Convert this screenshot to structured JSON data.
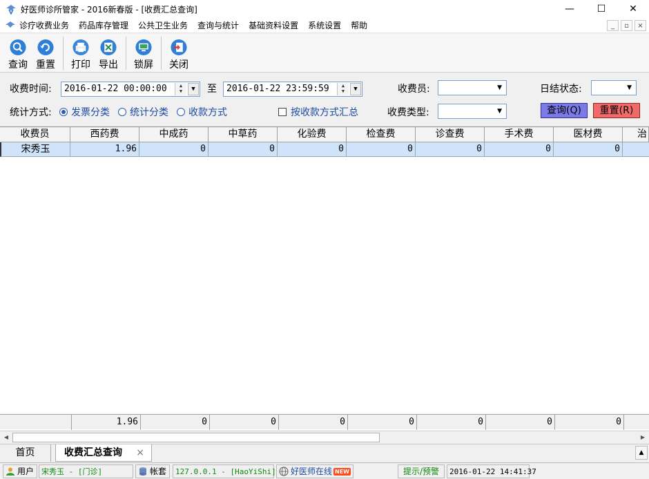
{
  "window": {
    "title": "好医师诊所管家 - 2016新春版 - [收费汇总查询]",
    "controls": [
      "—",
      "☐",
      "✕"
    ]
  },
  "menu": {
    "items": [
      "诊疗收费业务",
      "药品库存管理",
      "公共卫生业务",
      "查询与统计",
      "基础资料设置",
      "系统设置",
      "帮助"
    ],
    "mdi_controls": [
      "_",
      "▫",
      "×"
    ]
  },
  "toolbar": {
    "buttons": [
      {
        "label": "查询",
        "icon": "search-icon"
      },
      {
        "label": "重置",
        "icon": "refresh-icon"
      },
      {
        "label": "打印",
        "icon": "printer-icon"
      },
      {
        "label": "导出",
        "icon": "excel-icon"
      },
      {
        "label": "锁屏",
        "icon": "monitor-icon"
      },
      {
        "label": "关闭",
        "icon": "exit-icon"
      }
    ]
  },
  "filter": {
    "time_label": "收费时间:",
    "time_from": "2016-01-22 00:00:00",
    "to_label": "至",
    "time_to": "2016-01-22 23:59:59",
    "cashier_label": "收费员:",
    "cashier_value": "",
    "settle_label": "日结状态:",
    "settle_value": "",
    "method_label": "统计方式:",
    "radios": [
      {
        "label": "发票分类",
        "checked": true
      },
      {
        "label": "统计分类",
        "checked": false
      },
      {
        "label": "收款方式",
        "checked": false
      }
    ],
    "summary_check_label": "按收款方式汇总",
    "fee_type_label": "收费类型:",
    "fee_type_value": "",
    "query_button": "查询(Q)",
    "reset_button": "重置(R)"
  },
  "grid": {
    "columns": [
      "收费员",
      "西药费",
      "中成药",
      "中草药",
      "化验费",
      "检查费",
      "诊查费",
      "手术费",
      "医材费",
      "治"
    ],
    "rows": [
      [
        "宋秀玉",
        "1.96",
        "0",
        "0",
        "0",
        "0",
        "0",
        "0",
        "0",
        ""
      ]
    ],
    "totals": [
      "",
      "1.96",
      "0",
      "0",
      "0",
      "0",
      "0",
      "0",
      "0",
      ""
    ]
  },
  "tabs": {
    "home": "首页",
    "active": "收费汇总查询",
    "close": "×"
  },
  "status": {
    "user_label": "用户",
    "user_value": "宋秀玉 - [门诊]",
    "account_label": "帐套",
    "server": "127.0.0.1 - [HaoYiShi]",
    "online": "好医师在线",
    "new_badge": "NEW",
    "alert": "提示/预警",
    "datetime": "2016-01-22 14:41:37"
  }
}
